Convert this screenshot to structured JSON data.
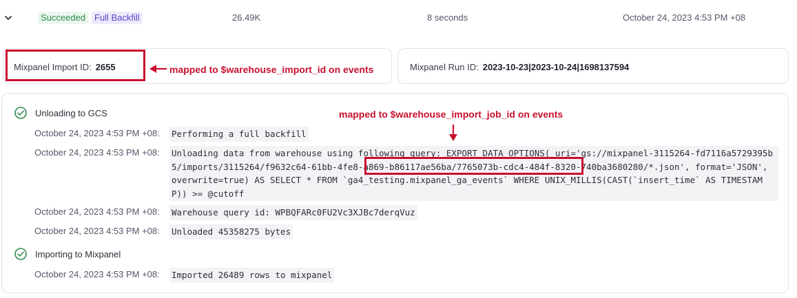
{
  "run": {
    "status": "Succeeded",
    "type": "Full Backfill",
    "rows": "26.49K",
    "duration": "8 seconds",
    "timestamp": "October 24, 2023 4:53 PM +08"
  },
  "import_id": {
    "label": "Mixpanel Import ID:",
    "value": "2655"
  },
  "run_id": {
    "label": "Mixpanel Run ID:",
    "value": "2023-10-23|2023-10-24|1698137594"
  },
  "annotations": {
    "import_id_note": "mapped to $warehouse_import_id on events",
    "job_id_note": "mapped to $warehouse_import_job_id on events"
  },
  "steps": [
    {
      "title": "Unloading to GCS",
      "logs": [
        {
          "ts": "October 24, 2023 4:53 PM +08:",
          "msg": "Performing a full backfill"
        },
        {
          "ts": "October 24, 2023 4:53 PM +08:",
          "msg": "Unloading data from warehouse using following query: EXPORT DATA OPTIONS( uri='gs://mixpanel-3115264-fd7116a5729395b5/imports/3115264/f9632c64-61bb-4fe8-a869-b86117ae56ba/7765073b-cdc4-484f-8320-740ba3680280/*.json', format='JSON', overwrite=true) AS SELECT * FROM `ga4_testing.mixpanel_ga_events` WHERE UNIX_MILLIS(CAST(`insert_time` AS TIMESTAMP)) >= @cutoff"
        },
        {
          "ts": "October 24, 2023 4:53 PM +08:",
          "msg": "Warehouse query id: WPBQFARc0FU2Vc3XJBc7derqVuz"
        },
        {
          "ts": "October 24, 2023 4:53 PM +08:",
          "msg": "Unloaded 45358275 bytes"
        }
      ]
    },
    {
      "title": "Importing to Mixpanel",
      "logs": [
        {
          "ts": "October 24, 2023 4:53 PM +08:",
          "msg": "Imported 26489 rows to mixpanel"
        }
      ]
    }
  ],
  "icons": {
    "expand": "chevron-down-icon",
    "step_done": "check-circle-icon",
    "arrow": "red-arrow-icon"
  },
  "colors": {
    "success": "#2f8a4f",
    "backfill": "#5b43c9",
    "annotation": "#c8102e"
  }
}
